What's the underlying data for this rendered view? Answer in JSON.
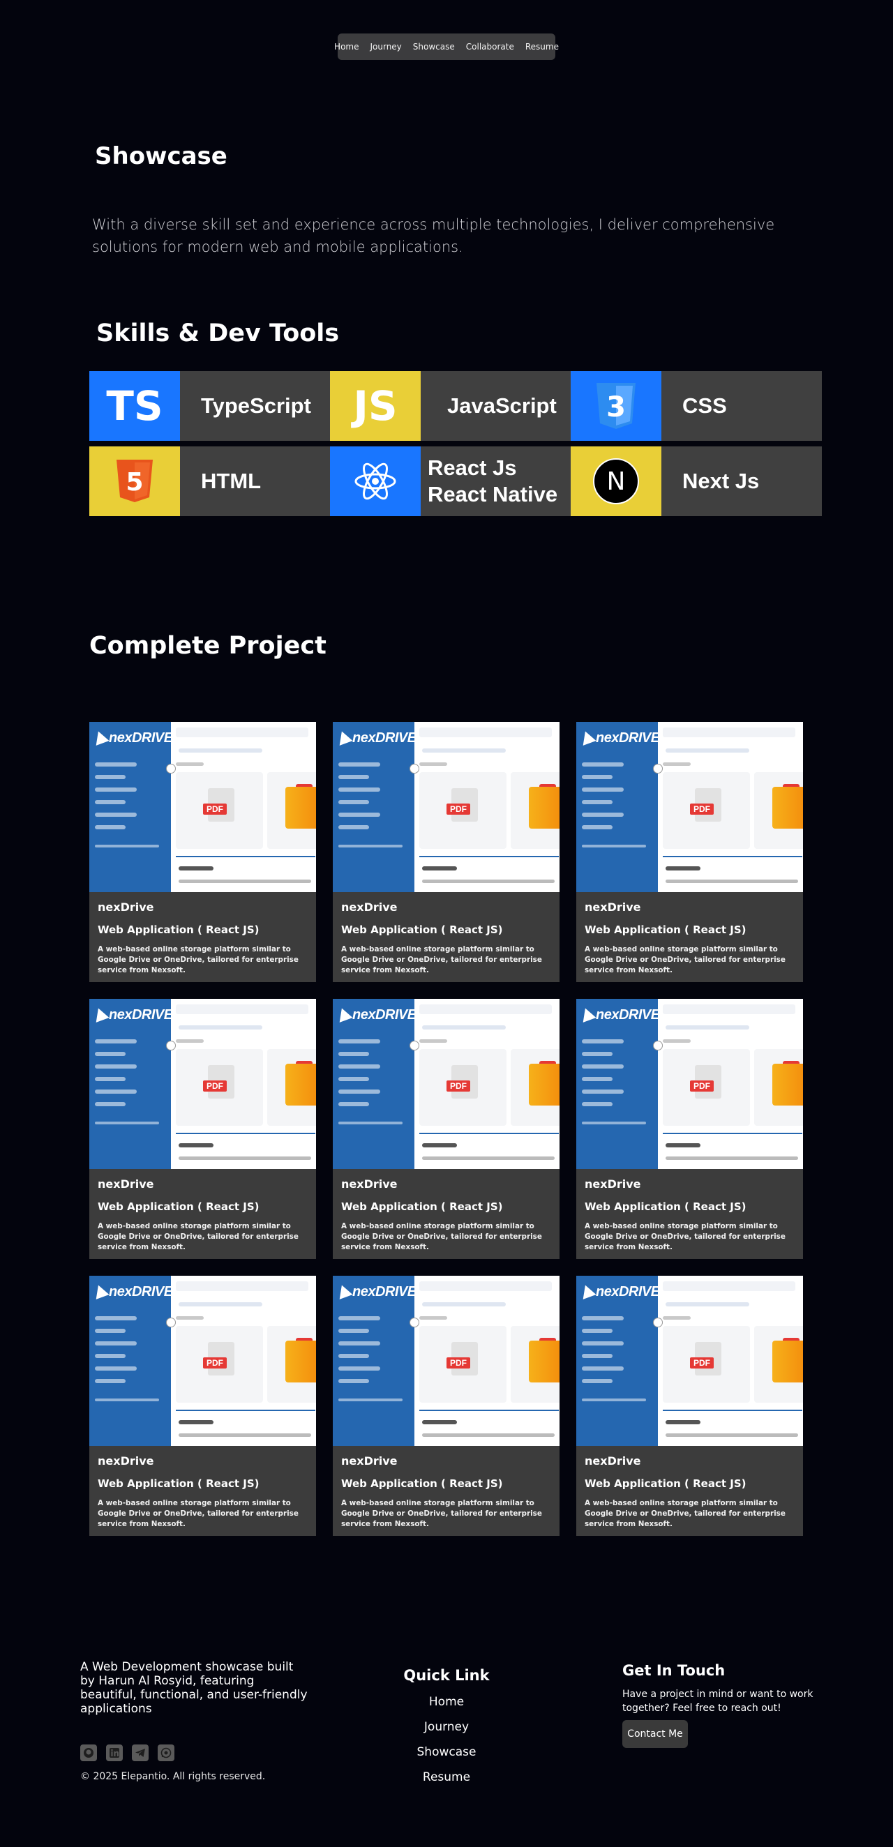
{
  "nav": {
    "items": [
      "Home",
      "Journey",
      "Showcase",
      "Collaborate",
      "Resume"
    ]
  },
  "hero": {
    "title": "Showcase",
    "text": "With a diverse skill set and experience across multiple technologies, I deliver comprehensive solutions for modern web and mobile applications."
  },
  "skills": {
    "title": "Skills & Dev Tools",
    "items": [
      {
        "name": "TypeScript",
        "logo_text": "TS",
        "logo_bg": "#1976ff",
        "icon": "typescript-icon"
      },
      {
        "name": "JavaScript",
        "logo_text": "JS",
        "logo_bg": "#e9cf37",
        "icon": "javascript-icon"
      },
      {
        "name": "CSS",
        "logo_text": "3",
        "logo_bg": "#1976ff",
        "icon": "css-icon"
      },
      {
        "name": "HTML",
        "logo_text": "5",
        "logo_bg": "#e9cf37",
        "icon": "html-icon"
      },
      {
        "name": "React Js\nReact Native",
        "logo_text": "",
        "logo_bg": "#1976ff",
        "icon": "react-icon"
      },
      {
        "name": "Next Js",
        "logo_text": "N",
        "logo_bg": "#e9cf37",
        "icon": "nextjs-icon"
      }
    ]
  },
  "projects": {
    "title": "Complete Project",
    "cards": [
      {
        "name": "nexDrive",
        "subtitle": "Web Application ( React JS)",
        "desc": "A web-based online storage platform similar to Google Drive or OneDrive, tailored for enterprise service from Nexsoft.",
        "thumb_logo": "nexDRIVE",
        "pdf": "PDF"
      },
      {
        "name": "nexDrive",
        "subtitle": "Web Application ( React JS)",
        "desc": "A web-based online storage platform similar to Google Drive or OneDrive, tailored for enterprise service from Nexsoft.",
        "thumb_logo": "nexDRIVE",
        "pdf": "PDF"
      },
      {
        "name": "nexDrive",
        "subtitle": "Web Application ( React JS)",
        "desc": "A web-based online storage platform similar to Google Drive or OneDrive, tailored for enterprise service from Nexsoft.",
        "thumb_logo": "nexDRIVE",
        "pdf": "PDF"
      },
      {
        "name": "nexDrive",
        "subtitle": "Web Application ( React JS)",
        "desc": "A web-based online storage platform similar to Google Drive or OneDrive, tailored for enterprise service from Nexsoft.",
        "thumb_logo": "nexDRIVE",
        "pdf": "PDF"
      },
      {
        "name": "nexDrive",
        "subtitle": "Web Application ( React JS)",
        "desc": "A web-based online storage platform similar to Google Drive or OneDrive, tailored for enterprise service from Nexsoft.",
        "thumb_logo": "nexDRIVE",
        "pdf": "PDF"
      },
      {
        "name": "nexDrive",
        "subtitle": "Web Application ( React JS)",
        "desc": "A web-based online storage platform similar to Google Drive or OneDrive, tailored for enterprise service from Nexsoft.",
        "thumb_logo": "nexDRIVE",
        "pdf": "PDF"
      },
      {
        "name": "nexDrive",
        "subtitle": "Web Application ( React JS)",
        "desc": "A web-based online storage platform similar to Google Drive or OneDrive, tailored for enterprise service from Nexsoft.",
        "thumb_logo": "nexDRIVE",
        "pdf": "PDF"
      },
      {
        "name": "nexDrive",
        "subtitle": "Web Application ( React JS)",
        "desc": "A web-based online storage platform similar to Google Drive or OneDrive, tailored for enterprise service from Nexsoft.",
        "thumb_logo": "nexDRIVE",
        "pdf": "PDF"
      },
      {
        "name": "nexDrive",
        "subtitle": "Web Application ( React JS)",
        "desc": "A web-based online storage platform similar to Google Drive or OneDrive, tailored for enterprise service from Nexsoft.",
        "thumb_logo": "nexDRIVE",
        "pdf": "PDF"
      }
    ]
  },
  "footer": {
    "desc": "A Web Development showcase built by Harun Al Rosyid, featuring beautiful, functional, and user-friendly applications",
    "socials": [
      "github-icon",
      "linkedin-icon",
      "telegram-icon",
      "whatsapp-icon"
    ],
    "copyright": "© 2025 Elepantio. All rights reserved.",
    "quick_link_title": "Quick Link",
    "quick_links": [
      "Home",
      "Journey",
      "Showcase",
      "Resume"
    ],
    "touch_title": "Get In Touch",
    "touch_text": "Have a project in mind or want to work together? Feel free to reach out!",
    "contact_label": "Contact Me"
  }
}
